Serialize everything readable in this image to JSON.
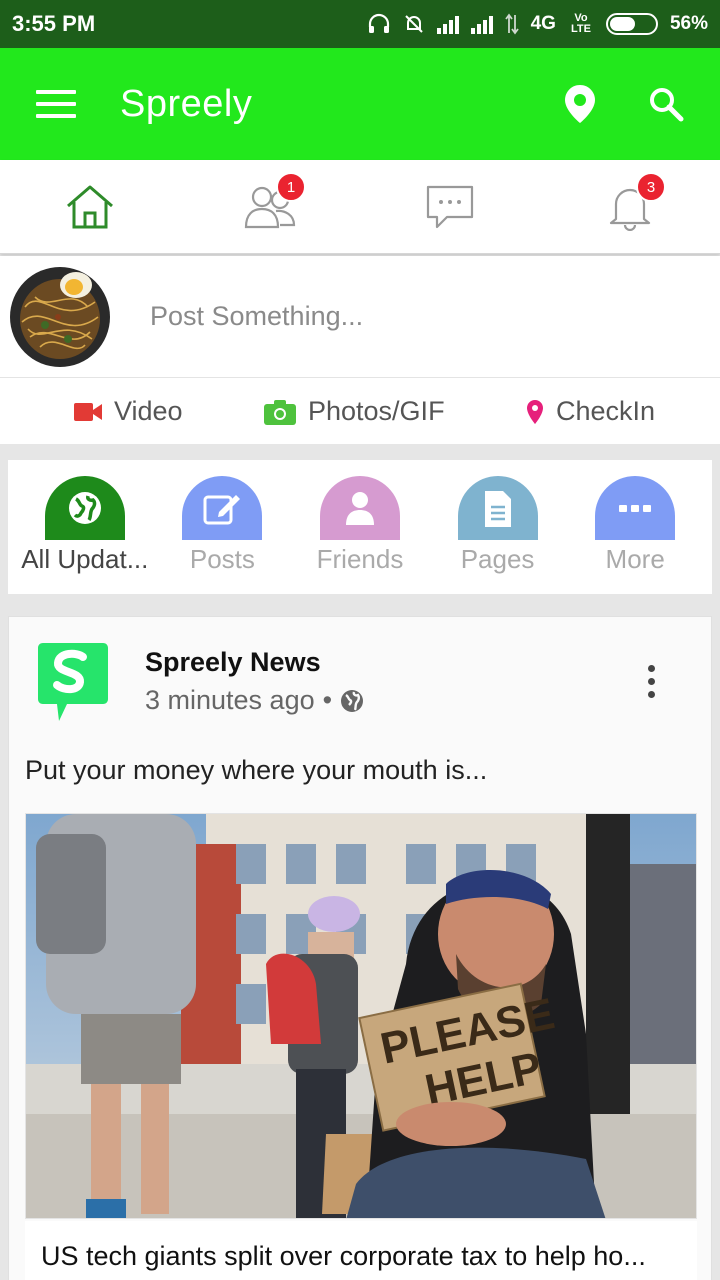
{
  "status": {
    "time": "3:55 PM",
    "network": "4G",
    "volte": "Vo LTE",
    "battery": "56%",
    "battery_level": 0.56
  },
  "appbar": {
    "title": "Spreely",
    "icons": [
      "menu-icon",
      "location-pin-icon",
      "search-icon"
    ]
  },
  "tabs": [
    {
      "name": "home",
      "icon": "home-icon",
      "badge": null,
      "color": "#2e8b2a"
    },
    {
      "name": "friend-requests",
      "icon": "friends-icon",
      "badge": "1"
    },
    {
      "name": "messages",
      "icon": "chat-icon",
      "badge": null
    },
    {
      "name": "notifications",
      "icon": "bell-icon",
      "badge": "3"
    }
  ],
  "composer": {
    "placeholder": "Post Something..."
  },
  "actions": {
    "video": "Video",
    "photos": "Photos/GIF",
    "checkin": "CheckIn"
  },
  "filters": [
    {
      "label": "All Updat...",
      "icon": "globe-icon",
      "color": "#1e8a1b",
      "active": true
    },
    {
      "label": "Posts",
      "icon": "edit-icon",
      "color": "#7f9cf5"
    },
    {
      "label": "Friends",
      "icon": "user-icon",
      "color": "#d69bd0"
    },
    {
      "label": "Pages",
      "icon": "document-icon",
      "color": "#7fb3cf"
    },
    {
      "label": "More",
      "icon": "more-icon",
      "color": "#7f9cf5"
    }
  ],
  "post": {
    "author": "Spreely News",
    "time": "3 minutes ago",
    "separator": "•",
    "text": "Put your money where your mouth is...",
    "sign_text_1": "PLEASE",
    "sign_text_2": "HELP",
    "headline": "US tech giants split over corporate tax to help ho..."
  },
  "colors": {
    "appbar": "#22e81c",
    "statusbar": "#1d5e1a",
    "badge": "#ea2330"
  }
}
